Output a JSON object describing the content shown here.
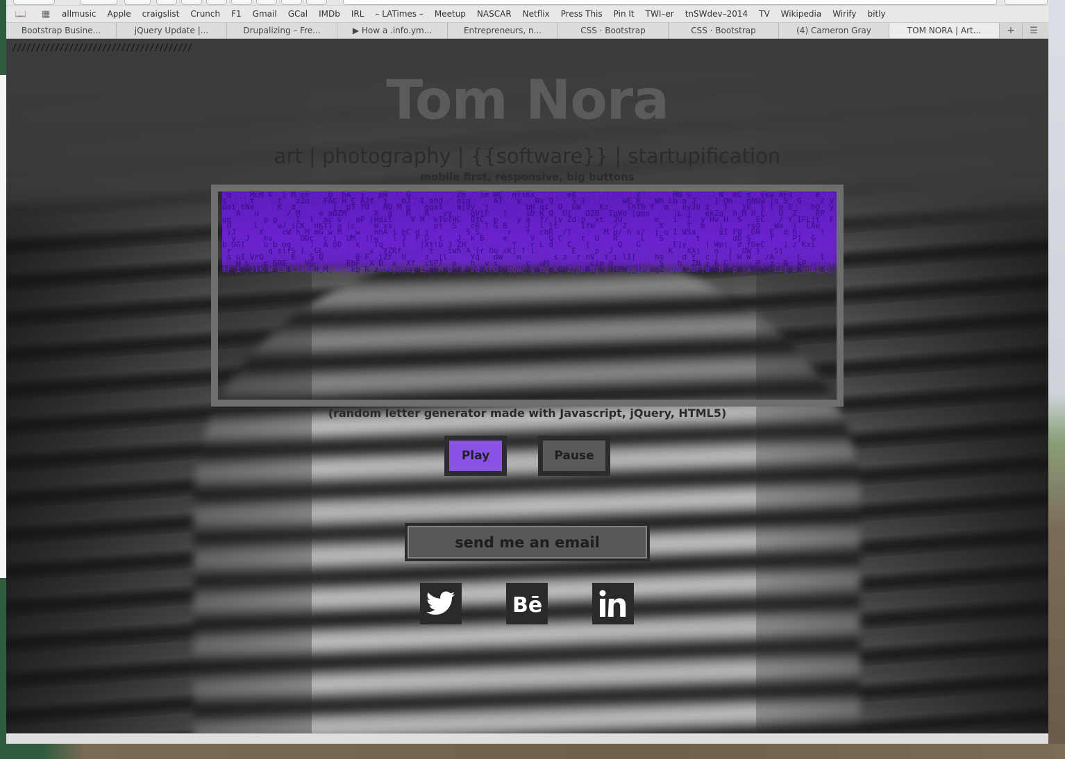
{
  "browser": {
    "bookmarks": [
      "allmusic",
      "Apple",
      "craigslist",
      "Crunch",
      "F1",
      "Gmail",
      "GCal",
      "IMDb",
      "IRL",
      "– LATimes –",
      "Meetup",
      "NASCAR",
      "Netflix",
      "Press This",
      "Pin It",
      "TWI–er",
      "tnSWdev–2014",
      "TV",
      "Wikipedia",
      "Wirify",
      "bitly"
    ],
    "tabs": [
      {
        "label": "Bootstrap Busine...",
        "active": false
      },
      {
        "label": "jQuery Update |...",
        "active": false
      },
      {
        "label": "Drupalizing – Fre...",
        "active": false
      },
      {
        "label": "▶ How a .info.ym...",
        "active": false
      },
      {
        "label": "Entrepreneurs, n...",
        "active": false
      },
      {
        "label": "CSS · Bootstrap",
        "active": false
      },
      {
        "label": "CSS · Bootstrap",
        "active": false
      },
      {
        "label": "(4) Cameron Gray",
        "active": false
      },
      {
        "label": "TOM NORA | Art...",
        "active": true
      }
    ]
  },
  "page": {
    "slashes": "//////////////////////////////////////",
    "title": "Tom Nora",
    "tagline": "art | photography | {{software}} | startupification",
    "subtagline": "mobile first, responsive, big buttons",
    "generator": {
      "caption": "(random letter generator made with Javascript, jQuery, HTML5)",
      "accent_color": "#6a22d0"
    },
    "buttons": {
      "play": "Play",
      "pause": "Pause",
      "email": "send me an email"
    },
    "social": [
      {
        "name": "twitter-icon"
      },
      {
        "name": "behance-icon"
      },
      {
        "name": "linkedin-icon"
      }
    ]
  }
}
